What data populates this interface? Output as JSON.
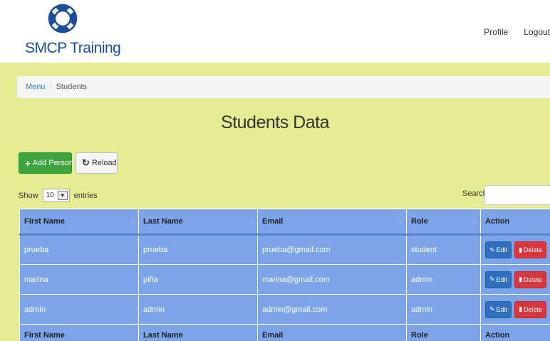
{
  "header": {
    "brand": "SMCP Training",
    "nav": [
      {
        "label": "Profile"
      },
      {
        "label": "Logout"
      }
    ]
  },
  "breadcrumb": {
    "menu": "Menu",
    "separator": "/",
    "current": "Students"
  },
  "page": {
    "title": "Students Data"
  },
  "toolbar": {
    "add_label": "Add Person",
    "reload_label": "Reload"
  },
  "table_controls": {
    "show": "Show",
    "page_size": "10",
    "entries": "entries",
    "search_label": "Search:",
    "search_value": ""
  },
  "table": {
    "columns": [
      "First Name",
      "Last Name",
      "Email",
      "Role",
      "Action"
    ],
    "rows": [
      {
        "first": "prueba",
        "last": "prueba",
        "email": "prueba@gmail.com",
        "role": "student"
      },
      {
        "first": "marina",
        "last": "piña",
        "email": "marina@gmail.com",
        "role": "admin"
      },
      {
        "first": "admin",
        "last": "admin",
        "email": "admin@gmail.com",
        "role": "admin"
      }
    ],
    "edit_label": "Edit",
    "delete_label": "Delete"
  },
  "icons": {
    "logo": "lifebuoy-icon",
    "add": "plus-icon",
    "reload": "refresh-icon",
    "sort": "sort-icon",
    "edit": "pencil-icon",
    "delete": "trash-icon"
  },
  "colors": {
    "brand": "#1a4d9c",
    "content_bg": "#e6ec91",
    "table_bg": "#7ba5e8",
    "add_button": "#3ea43e",
    "edit_button": "#2e6fbf",
    "delete_button": "#d9363e"
  }
}
